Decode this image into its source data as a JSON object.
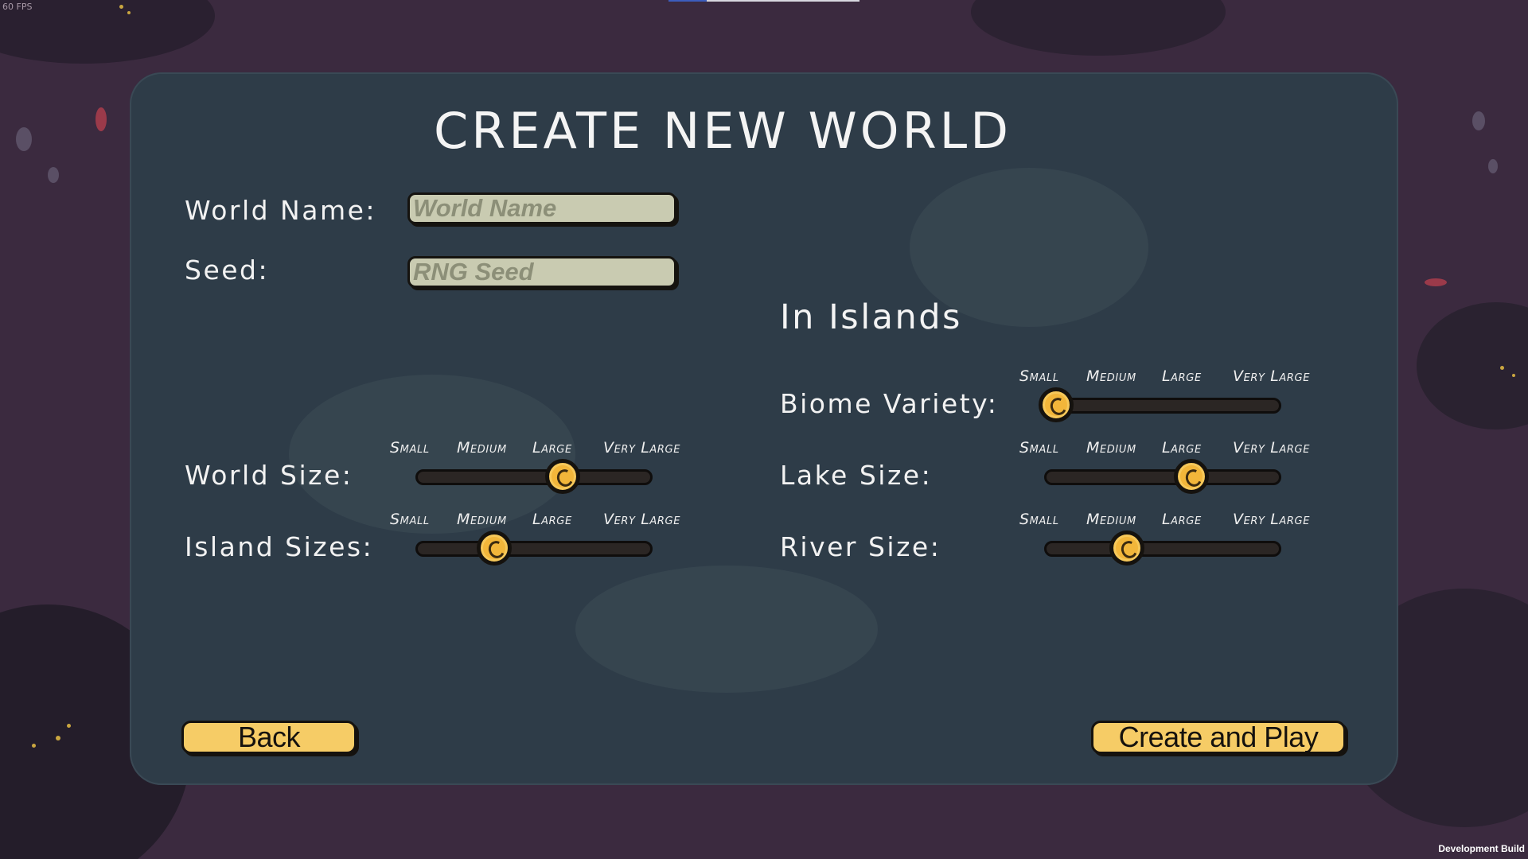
{
  "overlay": {
    "fps": "60 FPS",
    "build": "Development Build"
  },
  "title": "CREATE NEW WORLD",
  "fields": {
    "world_name": {
      "label": "World Name:",
      "placeholder": "World Name",
      "value": ""
    },
    "seed": {
      "label": "Seed:",
      "placeholder": "RNG Seed",
      "value": ""
    }
  },
  "tick_labels": [
    "Small",
    "Medium",
    "Large",
    "Very Large"
  ],
  "sliders_left": [
    {
      "key": "world_size",
      "label": "World Size:",
      "value_fraction": 0.67
    },
    {
      "key": "island_sizes",
      "label": "Island Sizes:",
      "value_fraction": 0.33
    }
  ],
  "section_title": "In Islands",
  "sliders_right": [
    {
      "key": "biome_variety",
      "label": "Biome Variety:",
      "value_fraction": 0.0
    },
    {
      "key": "lake_size",
      "label": "Lake Size:",
      "value_fraction": 0.67
    },
    {
      "key": "river_size",
      "label": "River Size:",
      "value_fraction": 0.35
    }
  ],
  "buttons": {
    "back": "Back",
    "create": "Create and Play"
  },
  "colors": {
    "background": "#3b2a3f",
    "panel": "#2e3c48",
    "field": "#c9cbb1",
    "button": "#f6cc66",
    "knob": "#f2b63a"
  }
}
